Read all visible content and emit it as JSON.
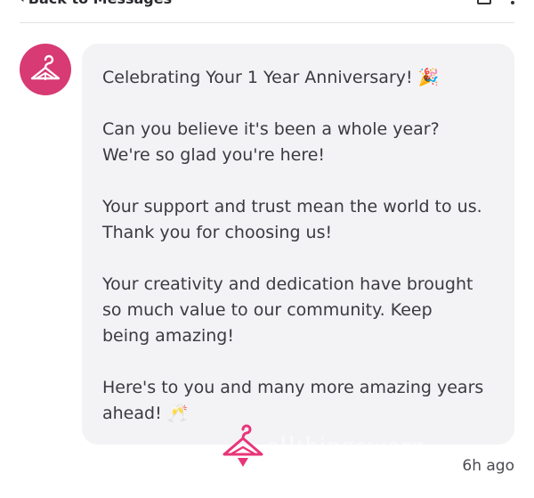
{
  "header": {
    "back_label": "Back to Messages",
    "back_icon": "chevron-left-icon",
    "compose_icon": "compose-icon",
    "more_icon": "more-vertical-icon"
  },
  "message": {
    "lines": [
      "Celebrating Your 1 Year Anniversary! 🎉",
      "Can you believe it's been a whole year?",
      "We're so glad you're here!",
      "Your support and trust mean the world to us.",
      "Thank you for choosing us!",
      "Your creativity and dedication have brought",
      "so much value to our community. Keep",
      "being amazing!",
      "Here's to you and many more amazing years",
      "ahead! 🥂"
    ],
    "timestamp": "6h ago"
  },
  "watermark": {
    "text": "allthingsworn"
  },
  "colors": {
    "brand": "#d83a73",
    "bubble": "#f3f3f6"
  }
}
